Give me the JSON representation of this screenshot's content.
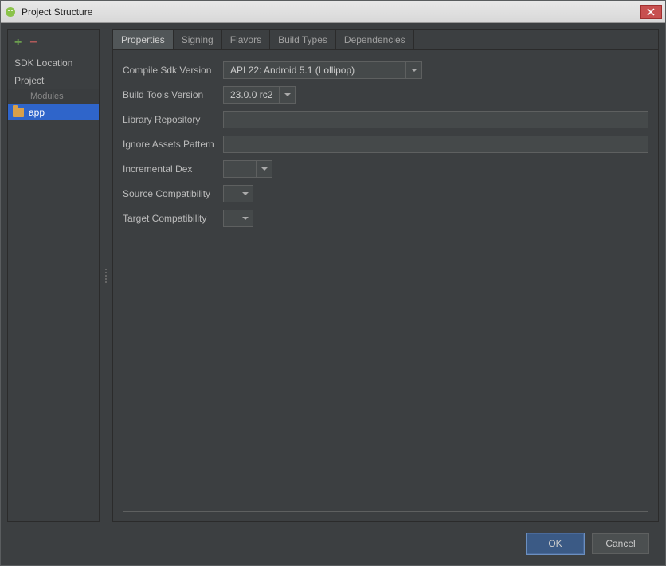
{
  "window": {
    "title": "Project Structure"
  },
  "sidebar": {
    "items": [
      "SDK Location",
      "Project"
    ],
    "section_label": "Modules",
    "modules": [
      "app"
    ]
  },
  "tabs": [
    "Properties",
    "Signing",
    "Flavors",
    "Build Types",
    "Dependencies"
  ],
  "form": {
    "compile_sdk": {
      "label": "Compile Sdk Version",
      "value": "API 22: Android 5.1 (Lollipop)"
    },
    "build_tools": {
      "label": "Build Tools Version",
      "value": "23.0.0 rc2"
    },
    "library_repo": {
      "label": "Library Repository",
      "value": ""
    },
    "ignore_assets": {
      "label": "Ignore Assets Pattern",
      "value": ""
    },
    "incremental_dex": {
      "label": "Incremental Dex",
      "value": ""
    },
    "source_compat": {
      "label": "Source Compatibility",
      "value": ""
    },
    "target_compat": {
      "label": "Target Compatibility",
      "value": ""
    }
  },
  "footer": {
    "ok": "OK",
    "cancel": "Cancel"
  }
}
